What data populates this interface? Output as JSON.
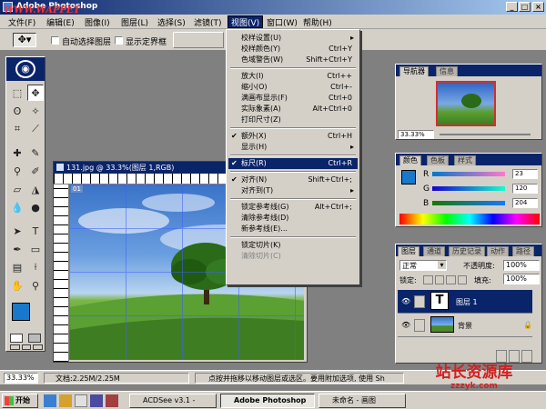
{
  "window": {
    "title": "Adobe Photoshop",
    "watermark": "WWW.WAPPET",
    "buttons": {
      "minimize": "_",
      "maximize": "□",
      "close": "×"
    }
  },
  "menubar": [
    {
      "label": "文件(F)"
    },
    {
      "label": "编辑(E)"
    },
    {
      "label": "图像(I)"
    },
    {
      "label": "图层(L)"
    },
    {
      "label": "选择(S)"
    },
    {
      "label": "滤镜(T)"
    },
    {
      "label": "视图(V)",
      "active": true
    },
    {
      "label": "窗口(W)"
    },
    {
      "label": "帮助(H)"
    }
  ],
  "options_bar": {
    "auto_select_layer": "自动选择图层",
    "show_bounding_box": "显示定界框"
  },
  "view_menu": [
    {
      "label": "校样设置(U)",
      "arrow": "▸"
    },
    {
      "label": "校样颜色(Y)",
      "shortcut": "Ctrl+Y"
    },
    {
      "label": "色域警告(W)",
      "shortcut": "Shift+Ctrl+Y"
    },
    {
      "sep": true
    },
    {
      "label": "放大(I)",
      "shortcut": "Ctrl++"
    },
    {
      "label": "缩小(O)",
      "shortcut": "Ctrl+-"
    },
    {
      "label": "满画布显示(F)",
      "shortcut": "Ctrl+0"
    },
    {
      "label": "实际象素(A)",
      "shortcut": "Alt+Ctrl+0"
    },
    {
      "label": "打印尺寸(Z)"
    },
    {
      "sep": true
    },
    {
      "label": "额外(X)",
      "shortcut": "Ctrl+H",
      "check": true
    },
    {
      "label": "显示(H)",
      "arrow": "▸"
    },
    {
      "sep": true
    },
    {
      "label": "标尺(R)",
      "shortcut": "Ctrl+R",
      "check": true,
      "highlight": true
    },
    {
      "sep": true
    },
    {
      "label": "对齐(N)",
      "shortcut": "Shift+Ctrl+;",
      "check": true
    },
    {
      "label": "对齐到(T)",
      "arrow": "▸"
    },
    {
      "sep": true
    },
    {
      "label": "锁定参考线(G)",
      "shortcut": "Alt+Ctrl+;"
    },
    {
      "label": "清除参考线(D)"
    },
    {
      "label": "新参考线(E)..."
    },
    {
      "sep": true
    },
    {
      "label": "锁定切片(K)"
    },
    {
      "label": "清除切片(C)",
      "disabled": true
    }
  ],
  "document": {
    "title": "131.jpg @ 33.3%(图层 1,RGB)",
    "slice_label": "01"
  },
  "navigator": {
    "tabs": [
      "导航器",
      "信息"
    ],
    "zoom": "33.33%"
  },
  "color_panel": {
    "tabs": [
      "颜色",
      "色板",
      "样式"
    ],
    "channels": [
      {
        "name": "R",
        "value": "23"
      },
      {
        "name": "G",
        "value": "120"
      },
      {
        "name": "B",
        "value": "204"
      }
    ],
    "foreground": "#1778cc"
  },
  "layers_panel": {
    "tabs": [
      "图层",
      "通道",
      "历史记录",
      "动作",
      "路径"
    ],
    "blend_mode": "正常",
    "opacity_label": "不透明度:",
    "opacity": "100%",
    "lock_label": "锁定:",
    "fill_label": "填充:",
    "fill": "100%",
    "layers": [
      {
        "name": "图层 1",
        "type": "text",
        "selected": true
      },
      {
        "name": "背景",
        "type": "image",
        "selected": false
      }
    ]
  },
  "status": {
    "zoom": "33.33%",
    "doc_size": "文档:2.25M/2.25M",
    "hint": "点按并拖移以移动图层或选区。要用附加选项, 使用 Sh"
  },
  "taskbar": {
    "start": "开始",
    "items": [
      {
        "label": "ACDSee v3.1 -"
      },
      {
        "label": "Adobe Photoshop",
        "active": true
      },
      {
        "label": "未命名 - 画图"
      }
    ]
  },
  "corner_watermark": {
    "cn": "站长资源库",
    "url": "zzzyk.com"
  }
}
